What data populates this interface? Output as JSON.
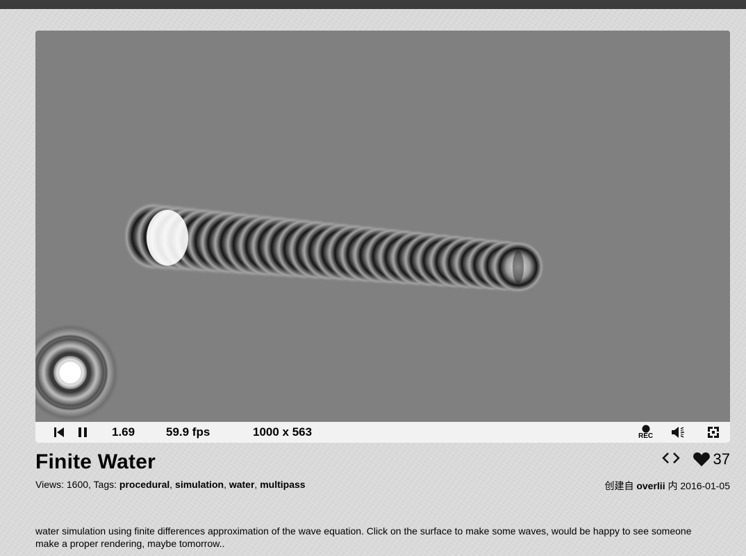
{
  "player": {
    "time": "1.69",
    "fps": "59.9 fps",
    "resolution": "1000 x 563",
    "rec_label": "REC",
    "canvas_background": "#808080"
  },
  "shader": {
    "title": "Finite Water",
    "views_prefix": "Views: 1600, Tags: ",
    "tags": [
      "procedural",
      "simulation",
      "water",
      "multipass"
    ],
    "likes": "37",
    "created_prefix": "创建自",
    "author": "overlii",
    "created_in": "内",
    "date": "2016-01-05",
    "description": "water simulation using finite differences approximation of the wave equation. Click on the surface to make some waves, would be happy to see someone make a proper rendering, maybe tomorrow.."
  },
  "icons": {
    "rewind": "skip-to-start-icon",
    "pause": "pause-icon",
    "record": "record-icon",
    "volume": "volume-icon",
    "fullscreen": "fullscreen-icon",
    "code": "code-icon",
    "like": "heart-icon"
  }
}
